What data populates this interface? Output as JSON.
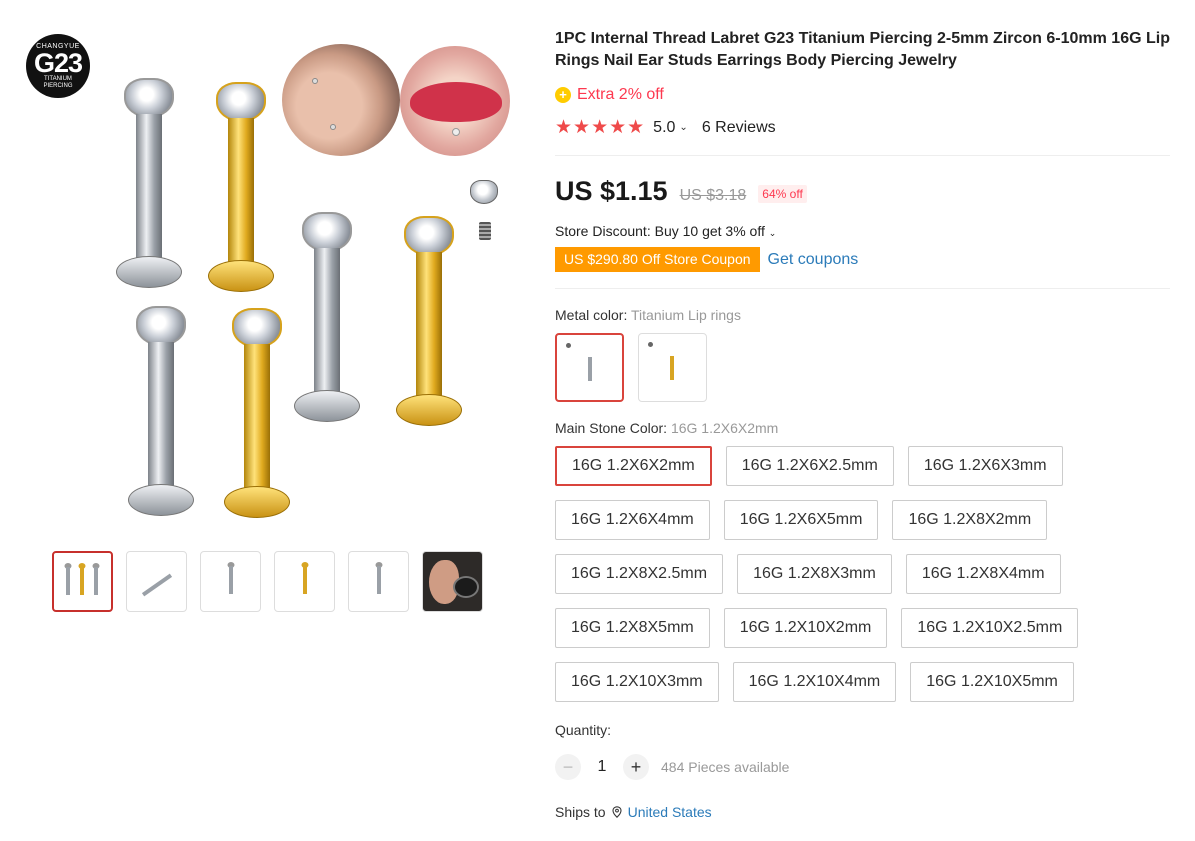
{
  "gallery": {
    "logo": {
      "top": "CHANGYUE",
      "main": "G23",
      "bottom_line1": "TITANIUM",
      "bottom_line2": "PIERCING"
    },
    "thumbnail_count": 6
  },
  "product": {
    "title": "1PC Internal Thread Labret G23 Titanium Piercing 2-5mm Zircon 6-10mm 16G Lip Rings Nail Ear Studs Earrings Body Piercing Jewelry",
    "extra_offer": "Extra 2% off",
    "stars": "★★★★★",
    "rating": "5.0",
    "reviews": "6 Reviews",
    "price": "US $1.15",
    "original_price": "US $3.18",
    "discount_pct": "64% off",
    "store_discount": "Store Discount: Buy 10 get 3% off",
    "coupon": "US $290.80 Off Store Coupon",
    "get_coupons": "Get coupons"
  },
  "metal_color": {
    "label": "Metal color: ",
    "value": "Titanium Lip rings",
    "options": [
      "Titanium Lip rings",
      "Gold Lip rings"
    ]
  },
  "stone_color": {
    "label": "Main Stone Color: ",
    "value": "16G 1.2X6X2mm",
    "options": [
      "16G 1.2X6X2mm",
      "16G 1.2X6X2.5mm",
      "16G 1.2X6X3mm",
      "16G 1.2X6X4mm",
      "16G 1.2X6X5mm",
      "16G 1.2X8X2mm",
      "16G 1.2X8X2.5mm",
      "16G 1.2X8X3mm",
      "16G 1.2X8X4mm",
      "16G 1.2X8X5mm",
      "16G 1.2X10X2mm",
      "16G 1.2X10X2.5mm",
      "16G 1.2X10X3mm",
      "16G 1.2X10X4mm",
      "16G 1.2X10X5mm"
    ]
  },
  "quantity": {
    "label": "Quantity:",
    "value": "1",
    "minus": "−",
    "plus": "+",
    "available": "484 Pieces available"
  },
  "shipping": {
    "label": "Ships to",
    "country": "United States"
  },
  "colors": {
    "price_red": "#fd384f",
    "star": "#ef4a4a",
    "coupon": "#ff9a00",
    "link": "#2b7bb9",
    "selected_border": "#d9443c"
  }
}
